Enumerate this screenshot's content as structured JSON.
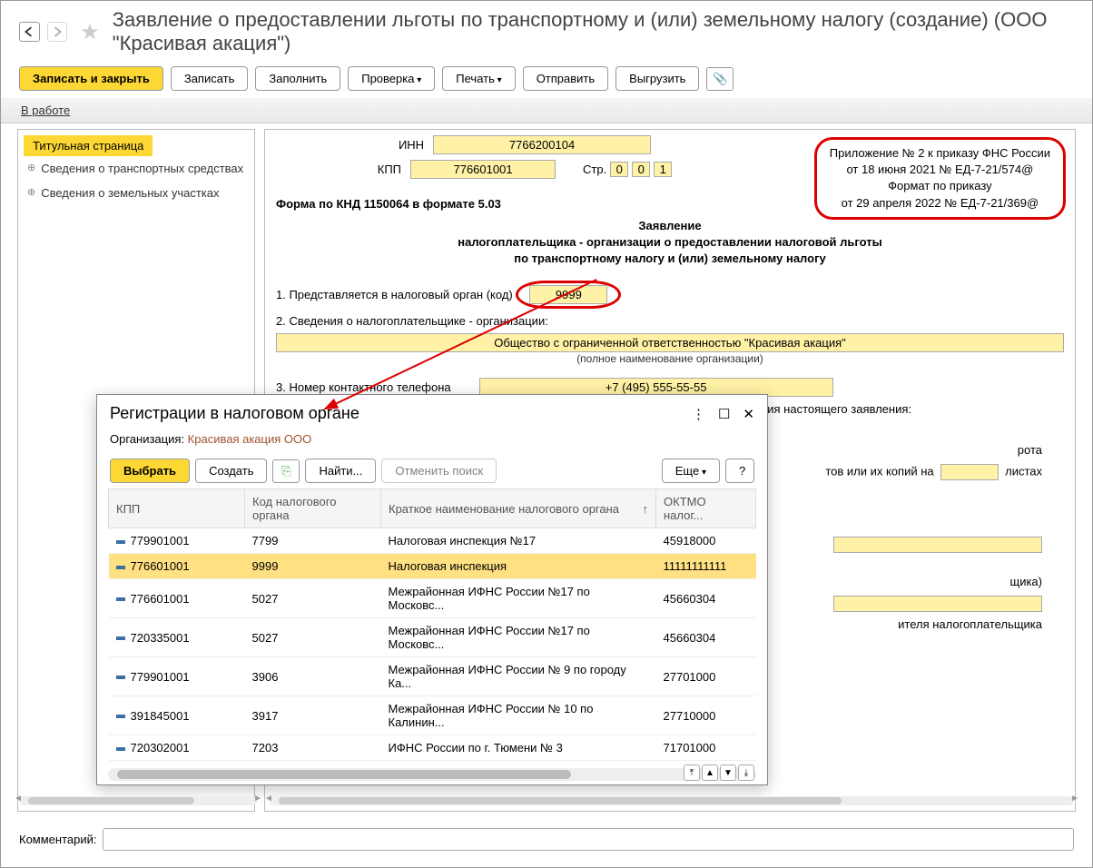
{
  "header": {
    "title": "Заявление о предоставлении льготы по транспортному и (или) земельному налогу (создание) (ООО \"Красивая акация\")"
  },
  "toolbar": {
    "save_close": "Записать и закрыть",
    "save": "Записать",
    "fill": "Заполнить",
    "check": "Проверка",
    "print": "Печать",
    "send": "Отправить",
    "upload": "Выгрузить"
  },
  "status": {
    "label": "В работе"
  },
  "sidebar": {
    "title": "Титульная страница",
    "items": [
      "Сведения о транспортных средствах",
      "Сведения о земельных участках"
    ]
  },
  "form": {
    "inn_label": "ИНН",
    "inn": "7766200104",
    "kpp_label": "КПП",
    "kpp": "776601001",
    "page_label": "Стр.",
    "page_d0": "0",
    "page_d1": "0",
    "page_d2": "1",
    "infobox_l1": "Приложение № 2 к приказу ФНС России",
    "infobox_l2": "от 18 июня 2021 № ЕД-7-21/574@",
    "infobox_l3": "Формат по приказу",
    "infobox_l4": "от 29 апреля 2022 № ЕД-7-21/369@",
    "knd": "Форма по КНД 1150064 в формате 5.03",
    "app_title1": "Заявление",
    "app_title2": "налогоплательщика - организации о предоставлении налоговой льготы",
    "app_title3": "по транспортному налогу и (или) земельному налогу",
    "line1_label": "1. Представляется в налоговый орган (код)",
    "tax_code": "9999",
    "line2_label": "2. Сведения о налогоплательщике - организации:",
    "org_full": "Общество с ограниченной ответственностью \"Красивая акация\"",
    "org_sub": "(полное наименование организации)",
    "line3_label": "3. Номер контактного телефона",
    "phone": "+7 (495) 555-55-55",
    "line4_label": "4. Способ информирования налогоплательщика - организации о результатах рассмотрения настоящего заявления:",
    "frag1": "рота",
    "frag2": "тов или их копий на",
    "leaves_label": "листах",
    "frag3": "щика)",
    "frag4": "ителя налогоплательщика"
  },
  "modal": {
    "title": "Регистрации в налоговом органе",
    "org_label": "Организация:",
    "org_val": "Красивая акация ООО",
    "toolbar": {
      "select": "Выбрать",
      "create": "Создать",
      "find": "Найти...",
      "cancel": "Отменить поиск",
      "more": "Еще",
      "help": "?"
    },
    "cols": {
      "kpp": "КПП",
      "code": "Код налогового органа",
      "name": "Краткое наименование налогового органа",
      "oktmo": "ОКТМО налог..."
    },
    "rows": [
      {
        "kpp": "779901001",
        "code": "7799",
        "name": "Налоговая инспекция №17",
        "oktmo": "45918000",
        "sel": false
      },
      {
        "kpp": "776601001",
        "code": "9999",
        "name": "Налоговая инспекция",
        "oktmo": "11111111111",
        "sel": true
      },
      {
        "kpp": "776601001",
        "code": "5027",
        "name": "Межрайонная ИФНС России №17 по Московс...",
        "oktmo": "45660304",
        "sel": false
      },
      {
        "kpp": "720335001",
        "code": "5027",
        "name": "Межрайонная ИФНС России №17 по Московс...",
        "oktmo": "45660304",
        "sel": false
      },
      {
        "kpp": "779901001",
        "code": "3906",
        "name": "Межрайонная ИФНС России № 9 по городу Ка...",
        "oktmo": "27701000",
        "sel": false
      },
      {
        "kpp": "391845001",
        "code": "3917",
        "name": "Межрайонная ИФНС России № 10 по Калинин...",
        "oktmo": "27710000",
        "sel": false
      },
      {
        "kpp": "720302001",
        "code": "7203",
        "name": "ИФНС России по г. Тюмени № 3",
        "oktmo": "71701000",
        "sel": false
      }
    ]
  },
  "comment": {
    "label": "Комментарий:",
    "value": ""
  }
}
